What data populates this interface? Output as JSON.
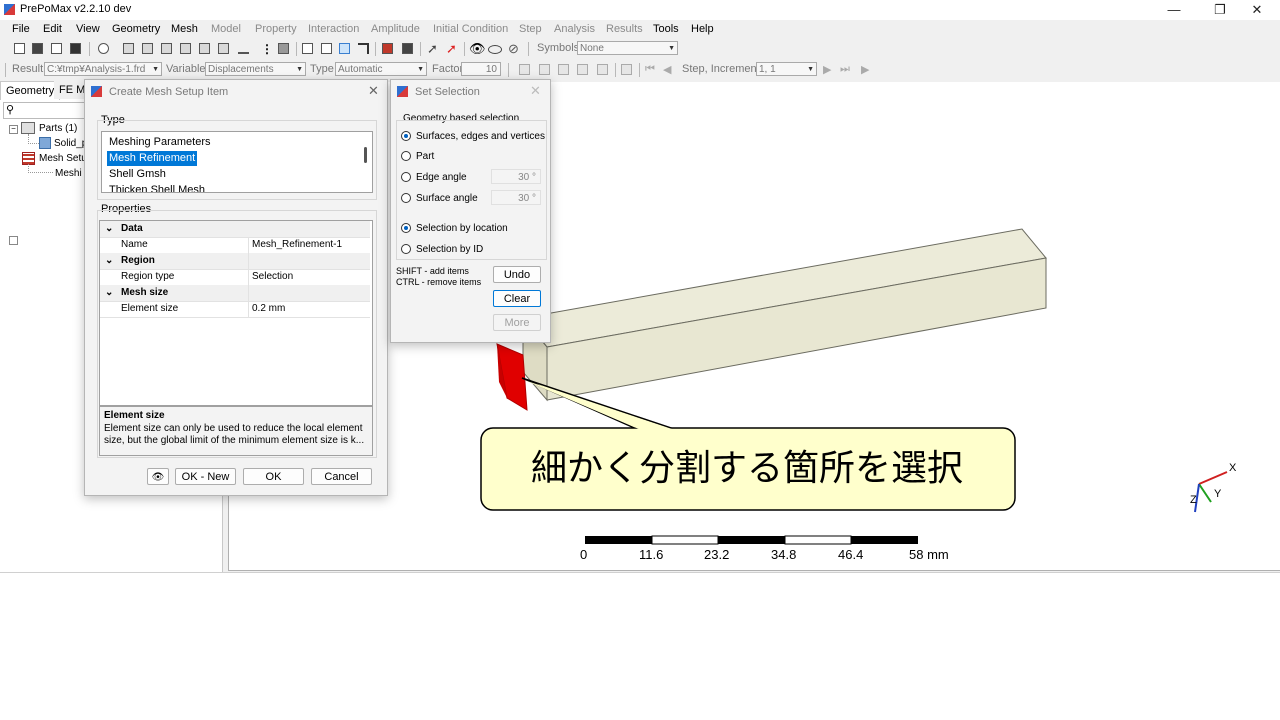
{
  "app": {
    "title": "PrePoMax v2.2.10 dev"
  },
  "menu": [
    {
      "label": "File",
      "disabled": false
    },
    {
      "label": "Edit",
      "disabled": false
    },
    {
      "label": "View",
      "disabled": false
    },
    {
      "label": "Geometry",
      "disabled": false
    },
    {
      "label": "Mesh",
      "disabled": false
    },
    {
      "label": "Model",
      "disabled": true
    },
    {
      "label": "Property",
      "disabled": true
    },
    {
      "label": "Interaction",
      "disabled": true
    },
    {
      "label": "Amplitude",
      "disabled": true
    },
    {
      "label": "Initial Condition",
      "disabled": true
    },
    {
      "label": "Step",
      "disabled": true
    },
    {
      "label": "Analysis",
      "disabled": true
    },
    {
      "label": "Results",
      "disabled": true
    },
    {
      "label": "Tools",
      "disabled": false
    },
    {
      "label": "Help",
      "disabled": false
    }
  ],
  "toolbar1": {
    "symbols_label": "Symbols",
    "symbols_value": "None"
  },
  "toolbar2": {
    "result_label": "Result",
    "result_value": "C:¥tmp¥Analysis-1.frd",
    "variable_label": "Variable",
    "variable_value": "Displacements",
    "type_label": "Type",
    "type_value": "Automatic",
    "factor_label": "Factor",
    "factor_value": "10",
    "step_label": "Step, Increment",
    "step_value": "1, 1"
  },
  "left_panel": {
    "tabs": [
      "Geometry",
      "FE Mo"
    ],
    "tree": [
      "Parts (1)",
      "Solid_p",
      "Mesh Setu",
      "Meshi"
    ]
  },
  "mesh_dialog": {
    "title": "Create Mesh Setup Item",
    "type_label": "Type",
    "type_items": [
      "Meshing Parameters",
      "Mesh Refinement",
      "Shell Gmsh",
      "Thicken Shell Mesh"
    ],
    "selected_type": "Mesh Refinement",
    "properties_label": "Properties",
    "properties": [
      {
        "category": "Data"
      },
      {
        "name": "Name",
        "value": "Mesh_Refinement-1"
      },
      {
        "category": "Region"
      },
      {
        "name": "Region type",
        "value": "Selection"
      },
      {
        "category": "Mesh size"
      },
      {
        "name": "Element size",
        "value": "0.2 mm"
      }
    ],
    "help_title": "Element size",
    "help_text": "Element size can only be used to reduce the local element size, but the global limit of the minimum element size is k...",
    "buttons": {
      "ok_new": "OK - New",
      "ok": "OK",
      "cancel": "Cancel"
    }
  },
  "selection_dialog": {
    "title": "Set Selection",
    "group_label": "Geometry based selection",
    "options": [
      {
        "label": "Surfaces, edges and vertices",
        "checked": true
      },
      {
        "label": "Part",
        "checked": false
      },
      {
        "label": "Edge angle",
        "checked": false,
        "value": "30 °"
      },
      {
        "label": "Surface angle",
        "checked": false,
        "value": "30 °"
      },
      {
        "label": "Selection by location",
        "checked": true
      },
      {
        "label": "Selection by ID",
        "checked": false
      }
    ],
    "hint_line1": "SHIFT - add items",
    "hint_line2": "CTRL - remove items",
    "buttons": {
      "undo": "Undo",
      "clear": "Clear",
      "more": "More"
    }
  },
  "viewport": {
    "callout_text": "細かく分割する箇所を選択",
    "scale_labels": [
      "0",
      "11.6",
      "23.2",
      "34.8",
      "46.4",
      "58 mm"
    ],
    "axes": {
      "x": "X",
      "y": "Y",
      "z": "Z"
    },
    "colors": {
      "beam_face": "#ecebd9",
      "beam_edge": "#6b6b60",
      "selection": "#e00000",
      "callout_fill": "#ffffcc"
    }
  }
}
